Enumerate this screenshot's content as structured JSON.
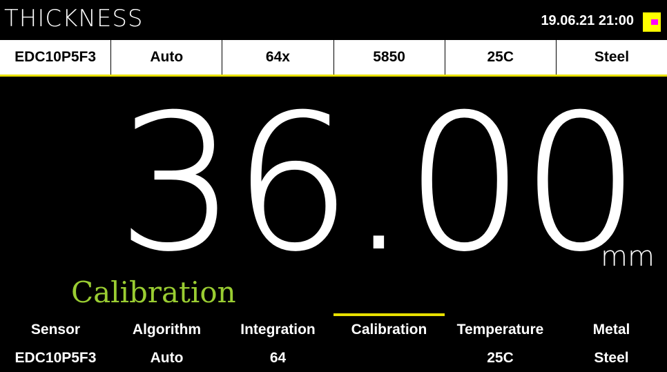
{
  "header": {
    "title": "THICKNESS",
    "datetime": "19.06.21  21:00",
    "indicator_colors": {
      "background": "#ffff00",
      "dot": "#ff00ff"
    }
  },
  "status_bar": [
    "EDC10P5F3",
    "Auto",
    "64x",
    "5850",
    "25C",
    "Steel"
  ],
  "display": {
    "reading": "36.00",
    "unit": "mm",
    "mode": "Calibration",
    "mode_color": "#9acd32"
  },
  "menu": [
    {
      "label": "Sensor",
      "value": "EDC10P5F3",
      "active": false
    },
    {
      "label": "Algorithm",
      "value": "Auto",
      "active": false
    },
    {
      "label": "Integration",
      "value": "64",
      "active": false
    },
    {
      "label": "Calibration",
      "value": "",
      "active": true
    },
    {
      "label": "Temperature",
      "value": "25C",
      "active": false
    },
    {
      "label": "Metal",
      "value": "Steel",
      "active": false
    }
  ],
  "accent_color": "#e8e000"
}
